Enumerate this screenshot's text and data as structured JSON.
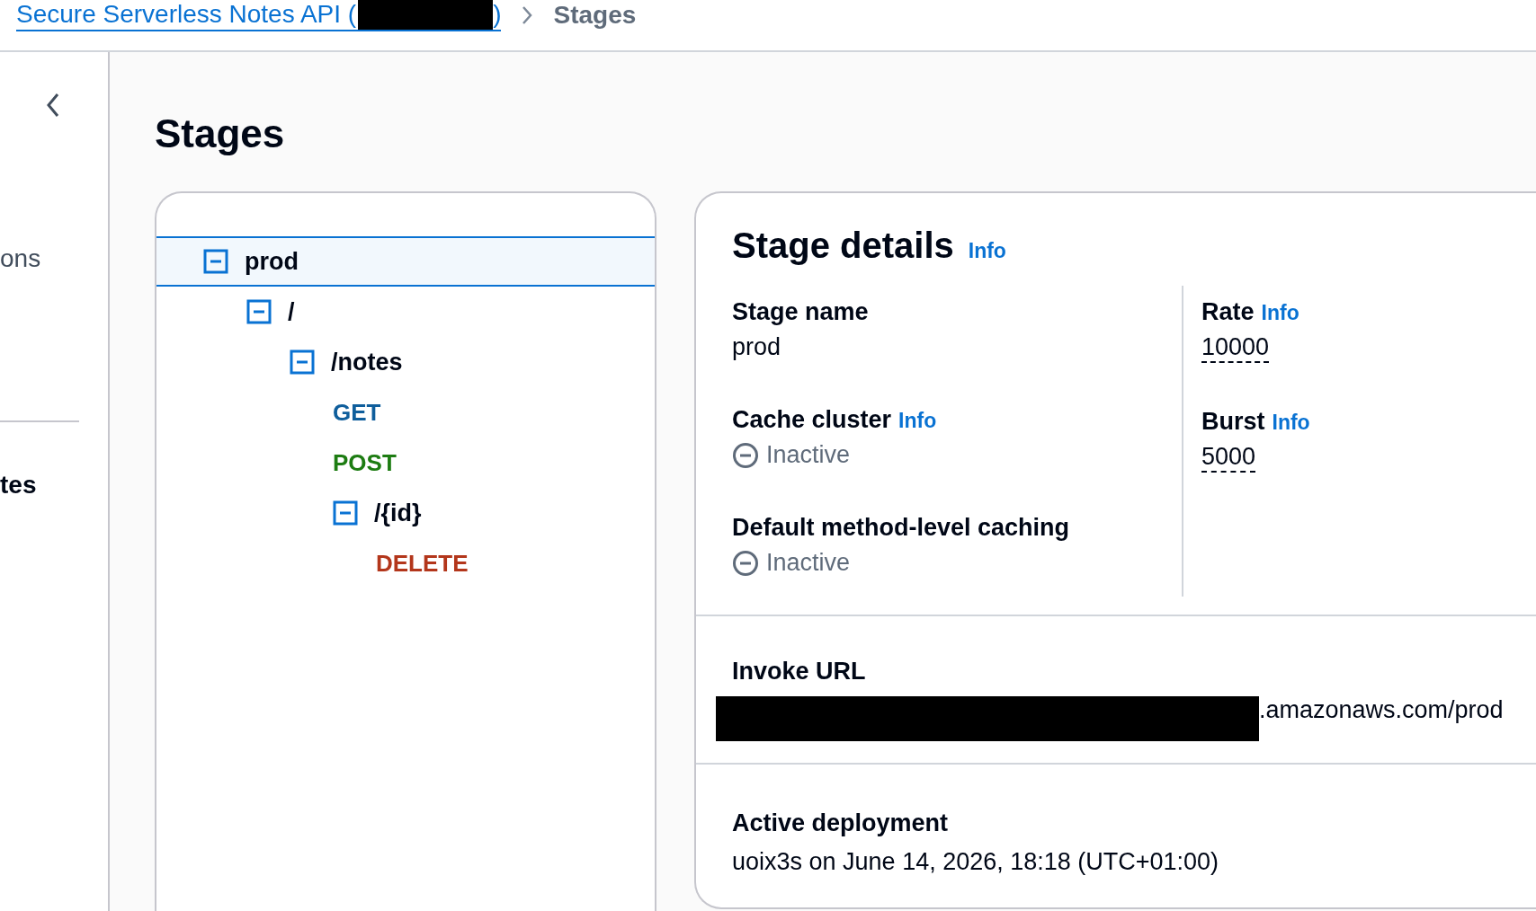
{
  "breadcrumb": {
    "link": "Secure Serverless Notes API (",
    "link_end": ")",
    "current": "Stages"
  },
  "sidebar": {
    "items": [
      "ons",
      "tes"
    ]
  },
  "page_title": "Stages",
  "tree": [
    {
      "kind": "resource",
      "label": "prod",
      "selected": true,
      "expanded": true,
      "children": [
        {
          "kind": "resource",
          "label": "/",
          "selected": false,
          "expanded": true,
          "children": [
            {
              "kind": "resource",
              "label": "/notes",
              "selected": false,
              "expanded": true,
              "children": [
                {
                  "kind": "method",
                  "label": "GET",
                  "selected": false,
                  "color": "#0f5e9c"
                },
                {
                  "kind": "method",
                  "label": "POST",
                  "selected": false,
                  "color": "#1d7c12"
                },
                {
                  "kind": "resource",
                  "label": "/{id}",
                  "selected": false,
                  "expanded": true,
                  "children": [
                    {
                      "kind": "method",
                      "label": "DELETE",
                      "selected": false,
                      "color": "#b3361b"
                    }
                  ]
                }
              ]
            }
          ]
        }
      ]
    }
  ],
  "details": {
    "title": "Stage details",
    "info": "Info",
    "left": [
      {
        "kind": "text",
        "label": "Stage name",
        "value": "prod"
      },
      {
        "kind": "status",
        "label": "Cache cluster",
        "info": "Info",
        "value": "Inactive"
      },
      {
        "kind": "status",
        "label": "Default method-level caching",
        "value": "Inactive"
      }
    ],
    "right": [
      {
        "kind": "number",
        "label": "Rate",
        "info": "Info",
        "value": "10000"
      },
      {
        "kind": "number",
        "label": "Burst",
        "info": "Info",
        "value": "5000"
      }
    ],
    "invoke_url": {
      "label": "Invoke URL",
      "value": ".amazonaws.com/prod"
    },
    "active_deployment": {
      "label": "Active deployment",
      "value": "uoix3s on June 14, 2026, 18:18 (UTC+01:00)"
    }
  }
}
